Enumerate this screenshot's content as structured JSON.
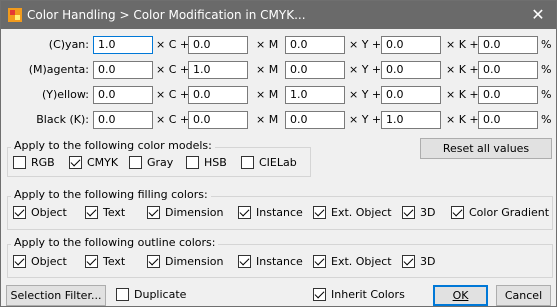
{
  "window": {
    "title": "Color Handling > Color Modification in CMYK..."
  },
  "rows": [
    {
      "label": "(C)yan:",
      "v1": "1.0",
      "v2": "0.0",
      "v3": "0.0",
      "v4": "0.0",
      "v5": "0.0"
    },
    {
      "label": "(M)agenta:",
      "v1": "0.0",
      "v2": "1.0",
      "v3": "0.0",
      "v4": "0.0",
      "v5": "0.0"
    },
    {
      "label": "(Y)ellow:",
      "v1": "0.0",
      "v2": "0.0",
      "v3": "1.0",
      "v4": "0.0",
      "v5": "0.0"
    },
    {
      "label": "Black (K):",
      "v1": "0.0",
      "v2": "0.0",
      "v3": "0.0",
      "v4": "1.0",
      "v5": "0.0"
    }
  ],
  "ops": {
    "c": "× C +",
    "m": "× M",
    "y": "× Y +",
    "k": "× K +",
    "pct": "%"
  },
  "reset_label": "Reset all values",
  "color_models": {
    "legend": "Apply to the following color models:",
    "items": [
      {
        "label": "RGB",
        "checked": false
      },
      {
        "label": "CMYK",
        "checked": true
      },
      {
        "label": "Gray",
        "checked": false
      },
      {
        "label": "HSB",
        "checked": false
      },
      {
        "label": "CIELab",
        "checked": false
      }
    ]
  },
  "filling": {
    "legend": "Apply to the following filling colors:",
    "items": [
      {
        "label": "Object",
        "checked": true
      },
      {
        "label": "Text",
        "checked": true
      },
      {
        "label": "Dimension",
        "checked": true
      },
      {
        "label": "Instance",
        "checked": true
      },
      {
        "label": "Ext. Object",
        "checked": true
      },
      {
        "label": "3D",
        "checked": true
      },
      {
        "label": "Color Gradient",
        "checked": true
      }
    ]
  },
  "outline": {
    "legend": "Apply to the following outline colors:",
    "items": [
      {
        "label": "Object",
        "checked": true
      },
      {
        "label": "Text",
        "checked": true
      },
      {
        "label": "Dimension",
        "checked": true
      },
      {
        "label": "Instance",
        "checked": true
      },
      {
        "label": "Ext. Object",
        "checked": true
      },
      {
        "label": "3D",
        "checked": true
      }
    ]
  },
  "footer": {
    "selection_filter": "Selection Filter...",
    "duplicate": "Duplicate",
    "duplicate_checked": false,
    "inherit": "Inherit Colors",
    "inherit_checked": true,
    "ok": "OK",
    "cancel": "Cancel"
  }
}
